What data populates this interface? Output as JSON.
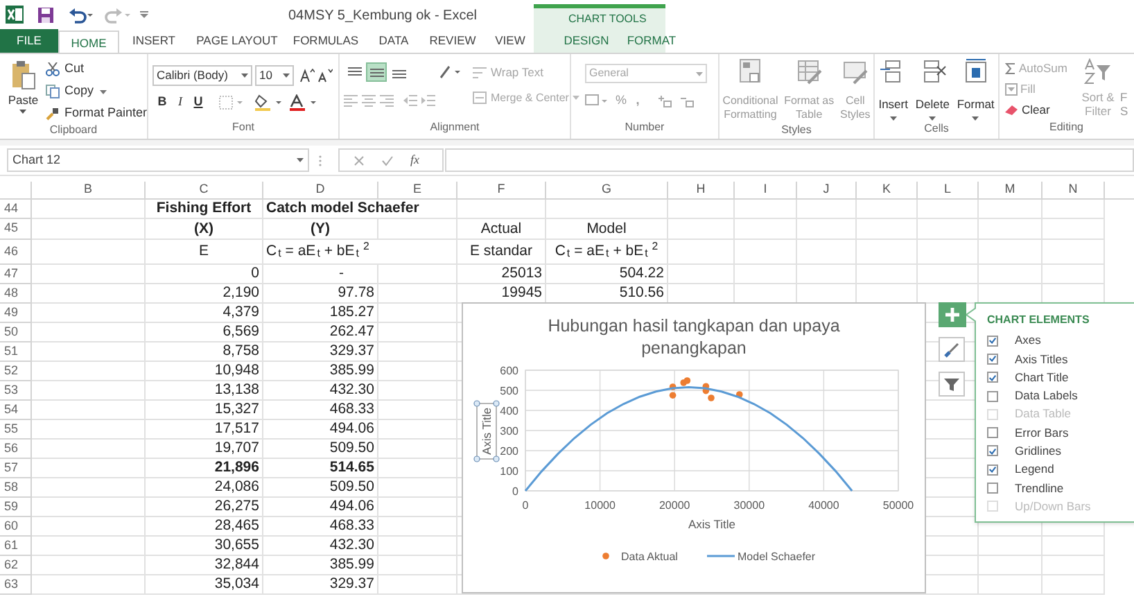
{
  "title_bar": {
    "title": "04MSY 5_Kembung ok - Excel",
    "contextual_label": "CHART TOOLS"
  },
  "tabs": [
    {
      "label": "FILE",
      "kind": "file",
      "selected": false
    },
    {
      "label": "HOME",
      "kind": "normal",
      "selected": true
    },
    {
      "label": "INSERT",
      "kind": "normal",
      "selected": false
    },
    {
      "label": "PAGE LAYOUT",
      "kind": "normal",
      "selected": false
    },
    {
      "label": "FORMULAS",
      "kind": "normal",
      "selected": false
    },
    {
      "label": "DATA",
      "kind": "normal",
      "selected": false
    },
    {
      "label": "REVIEW",
      "kind": "normal",
      "selected": false
    },
    {
      "label": "VIEW",
      "kind": "normal",
      "selected": false
    },
    {
      "label": "DESIGN",
      "kind": "contextual",
      "selected": false
    },
    {
      "label": "FORMAT",
      "kind": "contextual",
      "selected": false
    }
  ],
  "ribbon": {
    "clipboard": {
      "label": "Clipboard",
      "paste": "Paste",
      "cut": "Cut",
      "copy": "Copy",
      "format_painter": "Format Painter"
    },
    "font": {
      "label": "Font",
      "font_name": "Calibri (Body)",
      "font_size": "10",
      "bold": "B",
      "italic": "I",
      "underline": "U"
    },
    "alignment": {
      "label": "Alignment",
      "align_buttons": [
        {
          "selected": false
        },
        {
          "selected": true
        },
        {
          "selected": false
        }
      ],
      "wrap_text": {
        "label": "Wrap Text",
        "disabled": true
      },
      "merge_center": {
        "label": "Merge & Center",
        "disabled": true
      }
    },
    "number": {
      "label": "Number",
      "format": {
        "value": "General",
        "disabled": true
      },
      "percent": "%",
      "comma": ","
    },
    "styles": {
      "label": "Styles",
      "buttons": [
        {
          "lines": [
            "Conditional",
            "Formatting"
          ],
          "disabled": true
        },
        {
          "lines": [
            "Format as",
            "Table"
          ],
          "disabled": true
        },
        {
          "lines": [
            "Cell",
            "Styles"
          ],
          "disabled": true
        }
      ]
    },
    "cells": {
      "label": "Cells",
      "buttons": [
        {
          "label": "Insert",
          "disabled": false
        },
        {
          "label": "Delete",
          "disabled": false
        },
        {
          "label": "Format",
          "disabled": false
        }
      ]
    },
    "editing": {
      "label": "Editing",
      "autosum": {
        "label": "AutoSum",
        "disabled": true
      },
      "fill": {
        "label": "Fill",
        "disabled": true
      },
      "clear": {
        "label": "Clear",
        "disabled": false
      },
      "sort_filter": {
        "lines": [
          "Sort &",
          "Filter"
        ],
        "disabled": true
      },
      "find_select": {
        "lines": [
          "F",
          "S"
        ]
      }
    }
  },
  "formula_bar": {
    "name_box": "Chart 12",
    "fx": "fx"
  },
  "sheet": {
    "columns": [
      "B",
      "C",
      "D",
      "E",
      "F",
      "G",
      "H",
      "I",
      "J",
      "K",
      "L",
      "M",
      "N"
    ],
    "rows": [
      {
        "number": "44",
        "cells": {
          "C": {
            "text": "Fishing Effort",
            "kind": "label",
            "bold": true
          },
          "D": {
            "text": "Catch model Schaefer",
            "kind": "title",
            "bold": true
          }
        }
      },
      {
        "number": "45",
        "cells": {
          "C": {
            "text": "(X)",
            "kind": "label",
            "bold": true
          },
          "D": {
            "text": "(Y)",
            "kind": "label",
            "bold": true
          },
          "F": {
            "text": "Actual",
            "kind": "label",
            "bold": false
          },
          "G": {
            "text": "Model",
            "kind": "label",
            "bold": false
          }
        }
      },
      {
        "number": "46",
        "cells": {
          "C": {
            "text": "E",
            "kind": "label",
            "bold": false
          },
          "D": {
            "text": "C$_{t}$ = aE$_{t}$ + bE$_{t}$$^{2}$",
            "kind": "title",
            "bold": false
          },
          "F": {
            "text": "E standar",
            "kind": "label",
            "bold": false
          },
          "G": {
            "text": "C$_{t}$ = aE$_{t}$ + bE$_{t}$$^{2}$",
            "kind": "label",
            "bold": false
          }
        }
      },
      {
        "number": "47",
        "cells": {
          "C": {
            "text": "0",
            "kind": "number",
            "bold": false
          },
          "D": {
            "text": "-",
            "kind": "dash",
            "bold": false
          },
          "F": {
            "text": "25013",
            "kind": "number",
            "bold": false
          },
          "G": {
            "text": "504.22",
            "kind": "number",
            "bold": false
          }
        }
      },
      {
        "number": "48",
        "cells": {
          "C": {
            "text": "2,190",
            "kind": "number",
            "bold": false
          },
          "D": {
            "text": "97.78",
            "kind": "number",
            "bold": false
          },
          "F": {
            "text": "19945",
            "kind": "number",
            "bold": false
          },
          "G": {
            "text": "510.56",
            "kind": "number",
            "bold": false
          }
        }
      },
      {
        "number": "49",
        "cells": {
          "C": {
            "text": "4,379",
            "kind": "number",
            "bold": false
          },
          "D": {
            "text": "185.27",
            "kind": "number",
            "bold": false
          }
        }
      },
      {
        "number": "50",
        "cells": {
          "C": {
            "text": "6,569",
            "kind": "number",
            "bold": false
          },
          "D": {
            "text": "262.47",
            "kind": "number",
            "bold": false
          }
        }
      },
      {
        "number": "51",
        "cells": {
          "C": {
            "text": "8,758",
            "kind": "number",
            "bold": false
          },
          "D": {
            "text": "329.37",
            "kind": "number",
            "bold": false
          }
        }
      },
      {
        "number": "52",
        "cells": {
          "C": {
            "text": "10,948",
            "kind": "number",
            "bold": false
          },
          "D": {
            "text": "385.99",
            "kind": "number",
            "bold": false
          }
        }
      },
      {
        "number": "53",
        "cells": {
          "C": {
            "text": "13,138",
            "kind": "number",
            "bold": false
          },
          "D": {
            "text": "432.30",
            "kind": "number",
            "bold": false
          }
        }
      },
      {
        "number": "54",
        "cells": {
          "C": {
            "text": "15,327",
            "kind": "number",
            "bold": false
          },
          "D": {
            "text": "468.33",
            "kind": "number",
            "bold": false
          }
        }
      },
      {
        "number": "55",
        "cells": {
          "C": {
            "text": "17,517",
            "kind": "number",
            "bold": false
          },
          "D": {
            "text": "494.06",
            "kind": "number",
            "bold": false
          }
        }
      },
      {
        "number": "56",
        "cells": {
          "C": {
            "text": "19,707",
            "kind": "number",
            "bold": false
          },
          "D": {
            "text": "509.50",
            "kind": "number",
            "bold": false
          }
        }
      },
      {
        "number": "57",
        "cells": {
          "C": {
            "text": "21,896",
            "kind": "number",
            "bold": true
          },
          "D": {
            "text": "514.65",
            "kind": "number",
            "bold": true
          }
        }
      },
      {
        "number": "58",
        "cells": {
          "C": {
            "text": "24,086",
            "kind": "number",
            "bold": false
          },
          "D": {
            "text": "509.50",
            "kind": "number",
            "bold": false
          }
        }
      },
      {
        "number": "59",
        "cells": {
          "C": {
            "text": "26,275",
            "kind": "number",
            "bold": false
          },
          "D": {
            "text": "494.06",
            "kind": "number",
            "bold": false
          }
        }
      },
      {
        "number": "60",
        "cells": {
          "C": {
            "text": "28,465",
            "kind": "number",
            "bold": false
          },
          "D": {
            "text": "468.33",
            "kind": "number",
            "bold": false
          }
        }
      },
      {
        "number": "61",
        "cells": {
          "C": {
            "text": "30,655",
            "kind": "number",
            "bold": false
          },
          "D": {
            "text": "432.30",
            "kind": "number",
            "bold": false
          }
        }
      },
      {
        "number": "62",
        "cells": {
          "C": {
            "text": "32,844",
            "kind": "number",
            "bold": false
          },
          "D": {
            "text": "385.99",
            "kind": "number",
            "bold": false
          }
        }
      },
      {
        "number": "63",
        "cells": {
          "C": {
            "text": "35,034",
            "kind": "number",
            "bold": false
          },
          "D": {
            "text": "329.37",
            "kind": "number",
            "bold": false
          }
        }
      }
    ]
  },
  "chart": {
    "chart_data": {
      "type": "scatter",
      "title": "Hubungan hasil tangkapan dan upaya penangkapan",
      "xlabel": "Axis Title",
      "ylabel": "Axis Title",
      "xlim": [
        0,
        50000
      ],
      "ylim": [
        0,
        600
      ],
      "xticks": [
        {
          "value": 0,
          "label": "0"
        },
        10000,
        20000,
        30000,
        40000,
        50000
      ],
      "yticks": [
        {
          "value": 0,
          "label": "0"
        },
        100,
        200,
        300,
        400,
        500,
        600
      ],
      "grid": true,
      "legend": "bottom",
      "series": [
        {
          "name": "Data Aktual",
          "type": "scatter",
          "color": "#ed7d31",
          "x": [
            19760,
            19760,
            21200,
            21700,
            24200,
            24200,
            24900,
            28700
          ],
          "values": [
            517,
            475,
            538,
            548,
            520,
            498,
            462,
            479
          ]
        },
        {
          "name": "Model Schaefer",
          "type": "line",
          "color": "#5b9bd5",
          "x": [
            0,
            2190,
            4379,
            6569,
            8758,
            10948,
            13138,
            15327,
            17517,
            19707,
            21896,
            24086,
            26275,
            28465,
            30655,
            32844,
            35034,
            37223,
            39413,
            41603,
            43792
          ],
          "values": [
            0,
            98,
            185,
            262,
            329,
            386,
            432,
            468,
            494,
            510,
            515,
            510,
            494,
            468,
            432,
            386,
            329,
            262,
            185,
            98,
            0
          ]
        }
      ]
    }
  },
  "chart_elements": {
    "title": "CHART ELEMENTS",
    "items": [
      {
        "label": "Axes",
        "checked": true,
        "disabled": false
      },
      {
        "label": "Axis Titles",
        "checked": true,
        "disabled": false
      },
      {
        "label": "Chart Title",
        "checked": true,
        "disabled": false
      },
      {
        "label": "Data Labels",
        "checked": false,
        "disabled": false
      },
      {
        "label": "Data Table",
        "checked": false,
        "disabled": true
      },
      {
        "label": "Error Bars",
        "checked": false,
        "disabled": false
      },
      {
        "label": "Gridlines",
        "checked": true,
        "disabled": false
      },
      {
        "label": "Legend",
        "checked": true,
        "disabled": false
      },
      {
        "label": "Trendline",
        "checked": false,
        "disabled": false
      },
      {
        "label": "Up/Down Bars",
        "checked": false,
        "disabled": true
      }
    ]
  }
}
